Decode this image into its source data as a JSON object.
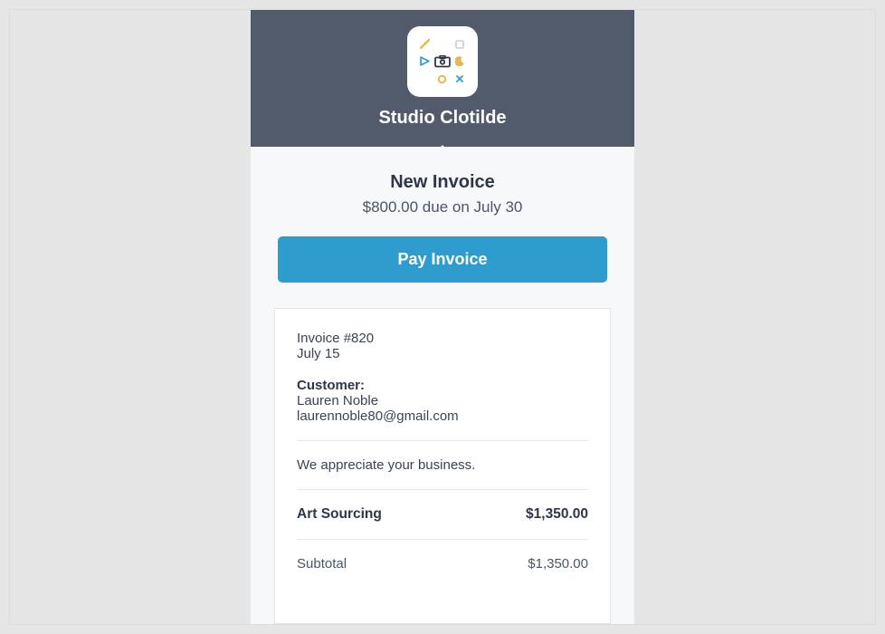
{
  "header": {
    "business_name": "Studio Clotilde"
  },
  "summary": {
    "title": "New Invoice",
    "due_line": "$800.00 due on July 30"
  },
  "actions": {
    "pay_label": "Pay Invoice"
  },
  "invoice": {
    "number_line": "Invoice #820",
    "date_line": "July 15",
    "customer_label": "Customer:",
    "customer_name": "Lauren Noble",
    "customer_email": "laurennoble80@gmail.com",
    "note": "We appreciate your business.",
    "line_items": [
      {
        "name": "Art Sourcing",
        "amount": "$1,350.00"
      }
    ],
    "subtotal_label": "Subtotal",
    "subtotal_amount": "$1,350.00"
  }
}
